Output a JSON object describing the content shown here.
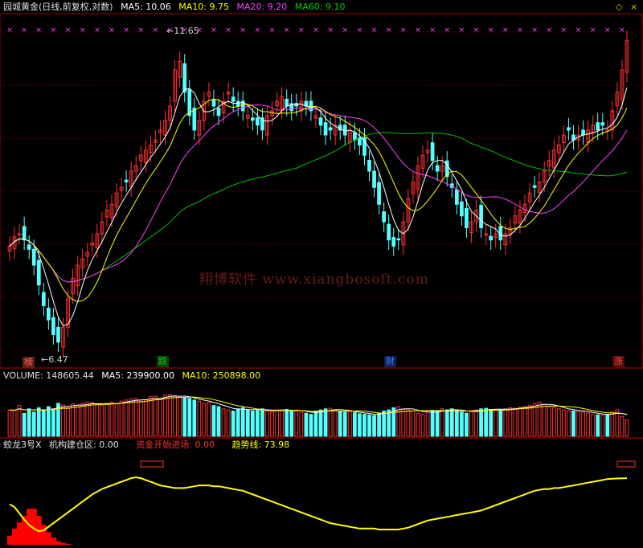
{
  "header": {
    "title": "园城黄金(日线,前复权,对数)",
    "ma5": "MA5: 10.06",
    "ma10": "MA10: 9.75",
    "ma20": "MA20: 9.20",
    "ma60": "MA60: 9.10",
    "controls": [
      "◇",
      "×"
    ]
  },
  "volume_header": {
    "volume": "VOLUME: 148605.44",
    "ma5": "MA5: 239900.00",
    "ma10": "MA10: 250898.00"
  },
  "indicator_header": {
    "name": "蛟龙3号X",
    "jgjc": "机构建仓区: 0.00",
    "zjks": "资金开始进场: 0.00",
    "qsx": "趋势线: 73.98"
  },
  "watermark": "翔博软件 www.xiangbosoft.com",
  "annotations": {
    "high": "11.65",
    "low": "6.47"
  },
  "event_tags": [
    {
      "label": "榜",
      "color": "#ff6060"
    },
    {
      "label": "跌",
      "color": "#00d000"
    },
    {
      "label": "财",
      "color": "#4080ff"
    },
    {
      "label": "涨",
      "color": "#ff4040"
    }
  ],
  "colors": {
    "up": "#ff3030",
    "down": "#54ffff",
    "ma5": "#ffffff",
    "ma10": "#ffff00",
    "ma20": "#ff40ff",
    "ma60": "#00c000",
    "marker": "#ff40ff",
    "trend": "#ffff00",
    "bars": "#ff0000"
  },
  "chart_data": [
    {
      "type": "candlestick",
      "title": "园城黄金(日线,前复权,对数)",
      "y_scale": "log",
      "ylim": [
        6.3,
        12.3
      ],
      "x_count": 128,
      "close": [
        7.9,
        8.05,
        8.1,
        8.0,
        7.85,
        7.6,
        7.3,
        7.0,
        6.8,
        6.6,
        6.5,
        6.7,
        7.1,
        7.4,
        7.6,
        7.7,
        7.8,
        7.95,
        8.1,
        8.3,
        8.5,
        8.6,
        8.8,
        8.9,
        9.0,
        9.2,
        9.3,
        9.5,
        9.6,
        9.7,
        9.8,
        10.0,
        10.2,
        10.5,
        11.3,
        11.5,
        10.8,
        10.3,
        10.0,
        10.2,
        10.6,
        10.8,
        10.5,
        10.3,
        10.6,
        10.8,
        10.6,
        10.5,
        10.4,
        10.3,
        10.2,
        10.1,
        10.0,
        10.3,
        10.4,
        10.6,
        10.7,
        10.5,
        10.4,
        10.5,
        10.6,
        10.5,
        10.4,
        10.3,
        10.1,
        9.9,
        10.0,
        10.1,
        10.0,
        9.9,
        10.0,
        9.8,
        9.7,
        9.5,
        9.2,
        8.9,
        8.6,
        8.3,
        8.0,
        7.9,
        8.0,
        8.3,
        8.7,
        9.0,
        9.3,
        9.5,
        9.6,
        9.4,
        9.2,
        9.3,
        9.1,
        8.9,
        8.6,
        8.4,
        8.2,
        8.3,
        8.5,
        8.2,
        8.1,
        8.0,
        8.1,
        8.0,
        8.1,
        8.2,
        8.4,
        8.5,
        8.6,
        8.8,
        8.9,
        9.0,
        9.2,
        9.4,
        9.6,
        9.7,
        9.9,
        10.0,
        9.8,
        9.9,
        9.9,
        10.0,
        10.1,
        10.0,
        10.1,
        10.0,
        10.4,
        10.8,
        11.3,
        12.0
      ],
      "markers_row": "×",
      "high_label": 11.65,
      "low_label": 6.47,
      "ma_legend": {
        "MA5": 10.06,
        "MA10": 9.75,
        "MA20": 9.2,
        "MA60": 9.1
      }
    },
    {
      "type": "bar",
      "title": "VOLUME",
      "values": [
        240,
        235,
        280,
        210,
        250,
        220,
        260,
        230,
        270,
        250,
        300,
        285,
        260,
        295,
        280,
        300,
        310,
        305,
        290,
        280,
        300,
        310,
        300,
        320,
        330,
        340,
        345,
        320,
        330,
        360,
        365,
        340,
        375,
        380,
        370,
        355,
        350,
        345,
        330,
        320,
        300,
        310,
        280,
        270,
        250,
        240,
        230,
        250,
        260,
        240,
        230,
        235,
        250,
        230,
        220,
        235,
        240,
        245,
        235,
        230,
        220,
        210,
        200,
        230,
        240,
        250,
        255,
        240,
        230,
        220,
        225,
        215,
        205,
        200,
        195,
        190,
        210,
        230,
        240,
        260,
        270,
        245,
        240,
        230,
        210,
        200,
        225,
        235,
        230,
        250,
        240,
        250,
        235,
        220,
        210,
        225,
        240,
        250,
        255,
        245,
        240,
        245,
        250,
        260,
        255,
        265,
        270,
        280,
        300,
        310,
        290,
        270,
        260,
        250,
        240,
        235,
        230,
        225,
        220,
        210,
        200,
        195,
        190,
        200,
        220,
        240,
        180,
        148.6
      ],
      "ma5": 239900.0,
      "ma10": 250898.0,
      "volume": 148605.44
    },
    {
      "type": "line",
      "title": "蛟龙3号X",
      "series": [
        {
          "name": "趋势线",
          "values": [
            45,
            42,
            35,
            28,
            22,
            18,
            15,
            16,
            20,
            24,
            28,
            32,
            36,
            40,
            44,
            48,
            52,
            56,
            59,
            62,
            64,
            66,
            68,
            70,
            72,
            74,
            75,
            74,
            72,
            70,
            68,
            66,
            65,
            64,
            63,
            63,
            63,
            64,
            65,
            66,
            66,
            66,
            65,
            65,
            64,
            63,
            62,
            61,
            60,
            58,
            56,
            54,
            52,
            50,
            48,
            46,
            44,
            42,
            40,
            38,
            36,
            34,
            32,
            30,
            28,
            26,
            24,
            23,
            22,
            21,
            20,
            19,
            18,
            18,
            18,
            18,
            17,
            17,
            17,
            17,
            17,
            18,
            19,
            21,
            23,
            25,
            27,
            28,
            29,
            30,
            31,
            32,
            33,
            34,
            35,
            36,
            37,
            38,
            40,
            42,
            44,
            46,
            48,
            50,
            52,
            54,
            56,
            58,
            60,
            61,
            62,
            62,
            63,
            63,
            64,
            65,
            66,
            67,
            68,
            69,
            70,
            71,
            72,
            73,
            73.5,
            73.7,
            73.9,
            73.98
          ]
        },
        {
          "name": "资金开始进场",
          "values": [
            10,
            18,
            25,
            32,
            40,
            40,
            32,
            22,
            14,
            8,
            4,
            2,
            1,
            0,
            0,
            0,
            0,
            0,
            0,
            0,
            0,
            0,
            0,
            0,
            0,
            0,
            0,
            0,
            0,
            0,
            0,
            0,
            0,
            0,
            0,
            0,
            0,
            0,
            0,
            0,
            0,
            0,
            0,
            0,
            0,
            0,
            0,
            0,
            0,
            0,
            0,
            0,
            0,
            0,
            0,
            0,
            0,
            0,
            0,
            0,
            0,
            0,
            0,
            0,
            0,
            0,
            0,
            0,
            0,
            0,
            0,
            0,
            0,
            0,
            0,
            0,
            0,
            0,
            0,
            0,
            0,
            0,
            0,
            0,
            0,
            0,
            0,
            0,
            0,
            0,
            0,
            0,
            0,
            0,
            0,
            0,
            0,
            0,
            0,
            0,
            0,
            0,
            0,
            0,
            0,
            0,
            0,
            0,
            0,
            0,
            0,
            0,
            0,
            0,
            0,
            0,
            0,
            0,
            0,
            0,
            0,
            0,
            0,
            0,
            0,
            0,
            0,
            0
          ]
        }
      ],
      "values_legend": {
        "机构建仓区": 0.0,
        "资金开始进场": 0.0,
        "趋势线": 73.98
      }
    }
  ]
}
